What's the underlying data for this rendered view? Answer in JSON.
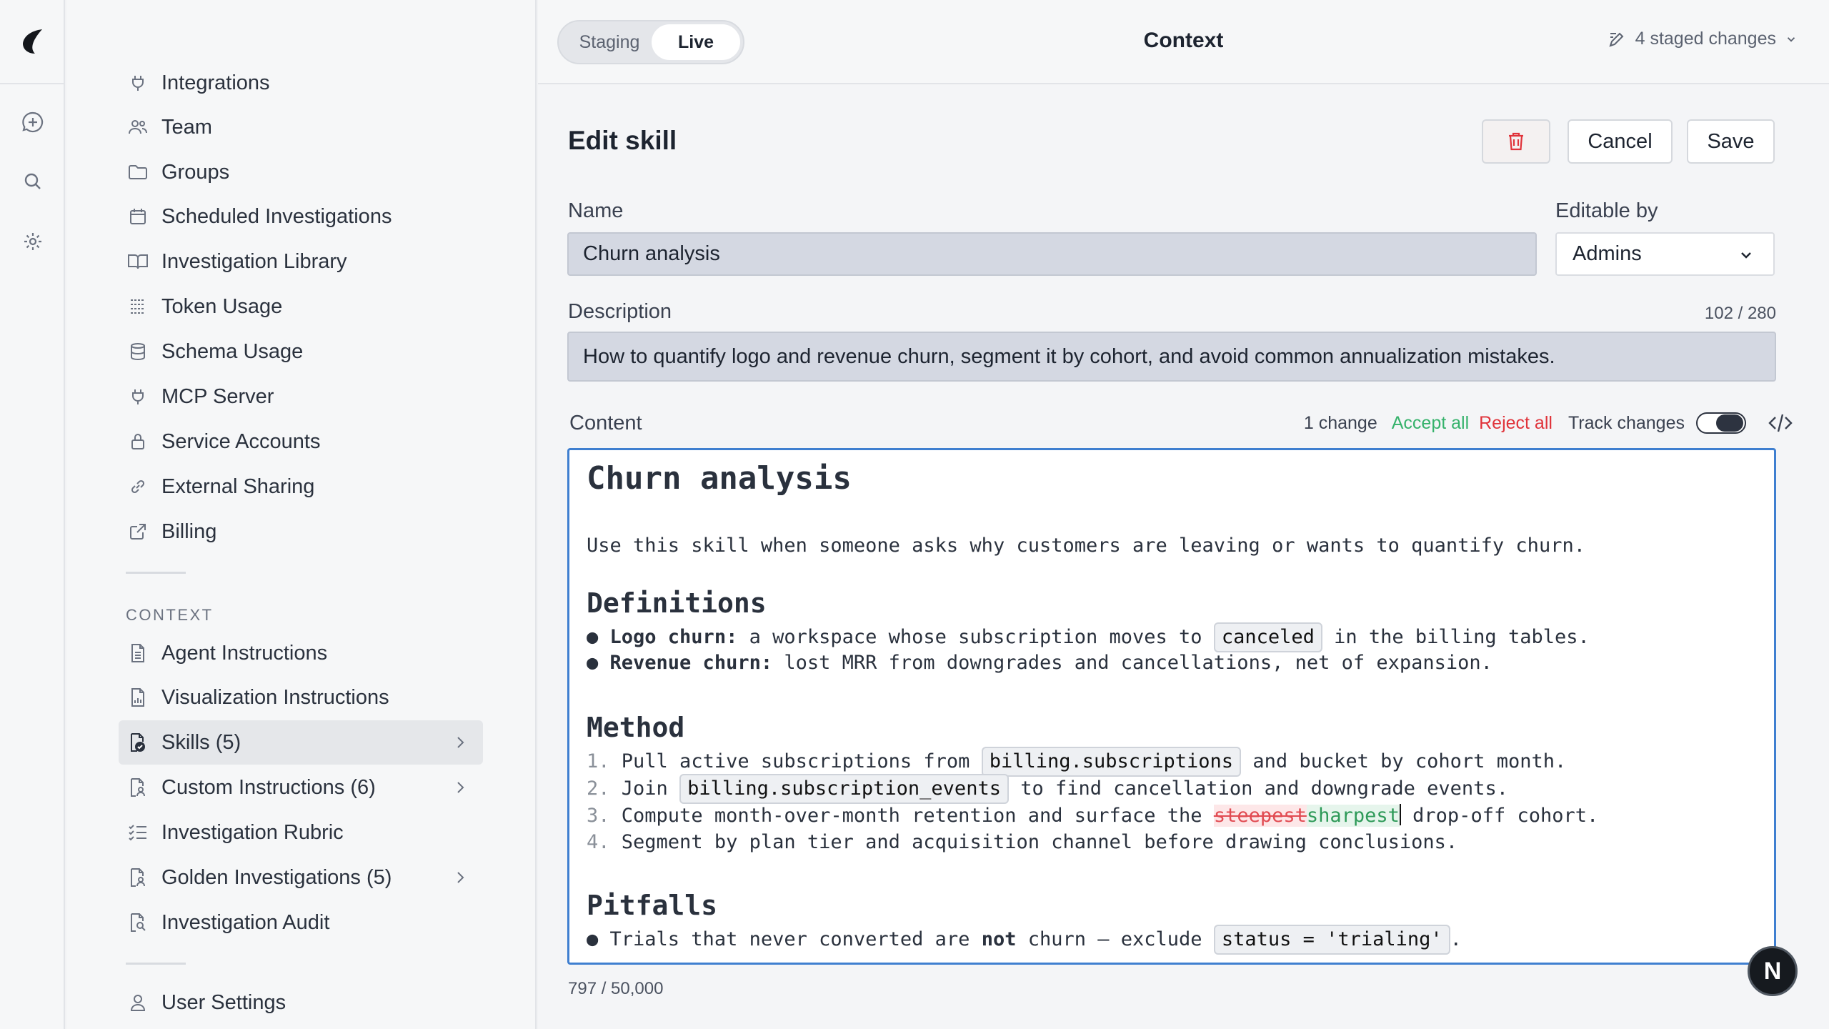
{
  "topbar": {
    "env_options": [
      "Staging",
      "Live"
    ],
    "env_selected": "Live",
    "title": "Context",
    "staged_changes": "4 staged changes"
  },
  "sidebar": {
    "items": [
      {
        "label": "Integrations",
        "icon": "plug-icon"
      },
      {
        "label": "Team",
        "icon": "users-icon"
      },
      {
        "label": "Groups",
        "icon": "folder-icon"
      },
      {
        "label": "Scheduled Investigations",
        "icon": "calendar-icon"
      },
      {
        "label": "Investigation Library",
        "icon": "book-icon"
      },
      {
        "label": "Token Usage",
        "icon": "bar-list-icon"
      },
      {
        "label": "Schema Usage",
        "icon": "database-icon"
      },
      {
        "label": "MCP Server",
        "icon": "plug-icon"
      },
      {
        "label": "Service Accounts",
        "icon": "lock-icon"
      },
      {
        "label": "External Sharing",
        "icon": "link-icon"
      },
      {
        "label": "Billing",
        "icon": "external-link-icon"
      }
    ],
    "context_label": "CONTEXT",
    "context_items": [
      {
        "label": "Agent Instructions",
        "icon": "document-icon"
      },
      {
        "label": "Visualization Instructions",
        "icon": "document-chart-icon"
      },
      {
        "label": "Skills (5)",
        "icon": "document-check-icon",
        "active": true
      },
      {
        "label": "Custom Instructions (6)",
        "icon": "document-user-icon"
      },
      {
        "label": "Investigation Rubric",
        "icon": "checklist-icon"
      },
      {
        "label": "Golden Investigations (5)",
        "icon": "document-user-icon"
      },
      {
        "label": "Investigation Audit",
        "icon": "document-search-icon"
      }
    ],
    "user_settings": "User Settings"
  },
  "edit": {
    "heading": "Edit skill",
    "cancel_label": "Cancel",
    "save_label": "Save",
    "name_label": "Name",
    "name_value": "Churn analysis",
    "editable_by_label": "Editable by",
    "editable_by_value": "Admins",
    "description_label": "Description",
    "description_counter": "102 / 280",
    "description_value": "How to quantify logo and revenue churn, segment it by cohort, and avoid common annualization mistakes.",
    "content_label": "Content",
    "change_count": "1 change",
    "accept_all": "Accept all",
    "reject_all": "Reject all",
    "track_changes": "Track changes",
    "content_counter": "797 / 50,000"
  },
  "editor": {
    "h1": "Churn analysis",
    "intro": "Use this skill when someone asks why customers are leaving or wants to quantify churn.",
    "h2_definitions": "Definitions",
    "def1_term": "Logo churn:",
    "def1_a": " a workspace whose subscription moves to ",
    "def1_code": "canceled",
    "def1_b": " in the billing tables.",
    "def2_term": "Revenue churn:",
    "def2_a": " lost MRR from downgrades and cancellations, net of expansion.",
    "h2_method": "Method",
    "m1_a": "Pull active subscriptions from ",
    "m1_code": "billing.subscriptions",
    "m1_b": " and bucket by cohort month.",
    "m2_a": "Join ",
    "m2_code": "billing.subscription_events",
    "m2_b": " to find cancellation and downgrade events.",
    "m3_a": "Compute month-over-month retention and surface the ",
    "m3_del": "steepest",
    "m3_ins": "sharpest",
    "m3_b": " drop-off cohort.",
    "m4_a": "Segment by plan tier and acquisition channel before drawing conclusions.",
    "h2_pitfalls": "Pitfalls",
    "p1_a": "Trials that never converted are ",
    "p1_bold": "not",
    "p1_b": " churn — exclude ",
    "p1_code": "status = 'trialing'",
    "p1_c": "."
  },
  "fab_label": "N"
}
